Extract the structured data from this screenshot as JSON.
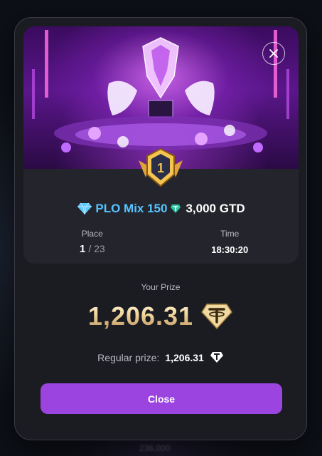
{
  "background": {
    "blurred_text": "236,000"
  },
  "card": {
    "place_badge": "1",
    "tournament": {
      "name": "PLO Mix 150",
      "prize_pool": "3,000 GTD"
    },
    "place": {
      "label": "Place",
      "value": "1",
      "total": "/ 23"
    },
    "time": {
      "label": "Time",
      "value": "18:30:20"
    }
  },
  "prize": {
    "label": "Your Prize",
    "amount": "1,206.31",
    "regular_label": "Regular prize:",
    "regular_value": "1,206.31"
  },
  "actions": {
    "close_label": "Close"
  },
  "colors": {
    "accent": "#9b44e0",
    "tournament_name": "#56c3ff",
    "gold": "#f0d49a",
    "tether": "#2ec4a0"
  },
  "icons": {
    "close": "close-icon",
    "diamond": "diamond-icon",
    "tether": "tether-icon",
    "medal": "gold-medal-icon"
  }
}
